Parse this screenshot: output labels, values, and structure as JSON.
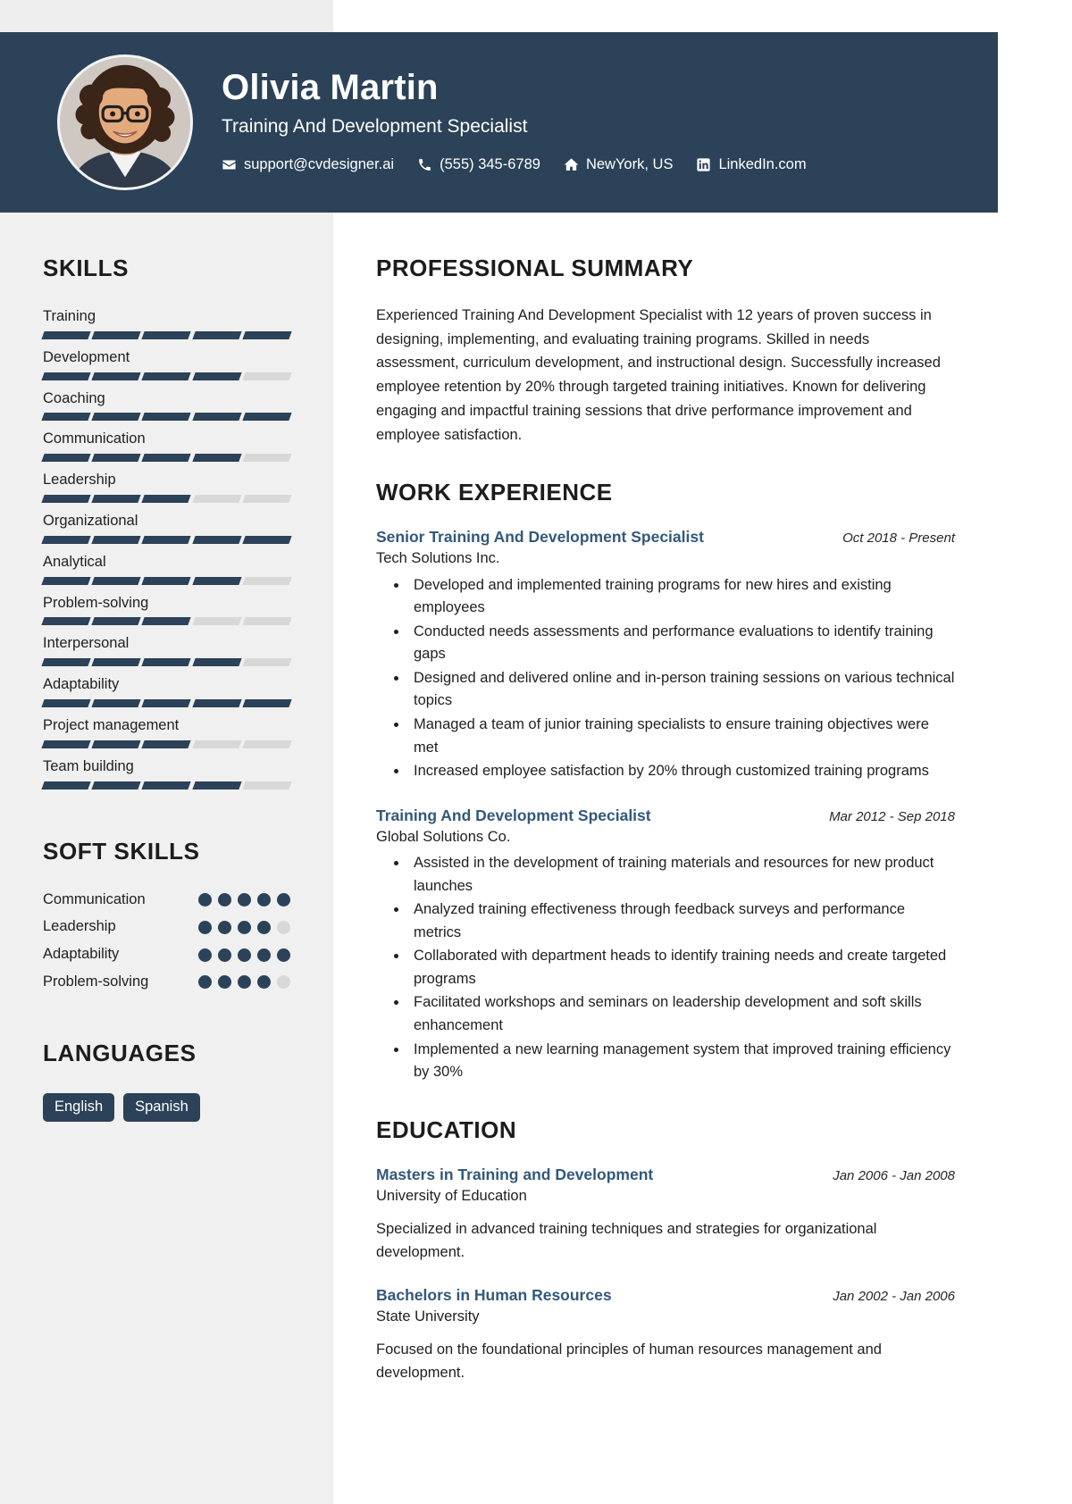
{
  "header": {
    "name": "Olivia Martin",
    "job_title": "Training And Development Specialist",
    "avatar_alt": "profile-photo",
    "contacts": [
      {
        "icon": "envelope-icon",
        "text": "support@cvdesigner.ai"
      },
      {
        "icon": "phone-icon",
        "text": "(555) 345-6789"
      },
      {
        "icon": "home-icon",
        "text": "NewYork, US"
      },
      {
        "icon": "linkedin-icon",
        "text": "LinkedIn.com"
      }
    ],
    "colors": {
      "banner": "#2b4258",
      "text": "#ffffff"
    }
  },
  "sidebar": {
    "skills_heading": "SKILLS",
    "skills_max": 5,
    "skills": [
      {
        "label": "Training",
        "level": 5
      },
      {
        "label": "Development",
        "level": 4
      },
      {
        "label": "Coaching",
        "level": 5
      },
      {
        "label": "Communication",
        "level": 4
      },
      {
        "label": "Leadership",
        "level": 3
      },
      {
        "label": "Organizational",
        "level": 5
      },
      {
        "label": "Analytical",
        "level": 4
      },
      {
        "label": "Problem-solving",
        "level": 3
      },
      {
        "label": "Interpersonal",
        "level": 4
      },
      {
        "label": "Adaptability",
        "level": 5
      },
      {
        "label": "Project management",
        "level": 3
      },
      {
        "label": "Team building",
        "level": 4
      }
    ],
    "soft_skills_heading": "SOFT SKILLS",
    "soft_skills_max": 5,
    "soft_skills": [
      {
        "label": "Communication",
        "level": 5
      },
      {
        "label": "Leadership",
        "level": 4
      },
      {
        "label": "Adaptability",
        "level": 5
      },
      {
        "label": "Problem-solving",
        "level": 4
      }
    ],
    "languages_heading": "LANGUAGES",
    "languages": [
      "English",
      "Spanish"
    ],
    "colors": {
      "background": "#f0f0f0",
      "filled": "#2b4258",
      "empty": "#d8d8d8"
    }
  },
  "main": {
    "summary_heading": "PROFESSIONAL SUMMARY",
    "summary_text": "Experienced Training And Development Specialist with 12 years of proven success in designing, implementing, and evaluating training programs. Skilled in needs assessment, curriculum development, and instructional design. Successfully increased employee retention by 20% through targeted training initiatives. Known for delivering engaging and impactful training sessions that drive performance improvement and employee satisfaction.",
    "experience_heading": "WORK EXPERIENCE",
    "experience": [
      {
        "title": "Senior Training And Development Specialist",
        "date": "Oct 2018 - Present",
        "company": "Tech Solutions Inc.",
        "bullets": [
          "Developed and implemented training programs for new hires and existing employees",
          "Conducted needs assessments and performance evaluations to identify training gaps",
          "Designed and delivered online and in-person training sessions on various technical topics",
          "Managed a team of junior training specialists to ensure training objectives were met",
          "Increased employee satisfaction by 20% through customized training programs"
        ]
      },
      {
        "title": "Training And Development Specialist",
        "date": "Mar 2012 - Sep 2018",
        "company": "Global Solutions Co.",
        "bullets": [
          "Assisted in the development of training materials and resources for new product launches",
          "Analyzed training effectiveness through feedback surveys and performance metrics",
          "Collaborated with department heads to identify training needs and create targeted programs",
          "Facilitated workshops and seminars on leadership development and soft skills enhancement",
          "Implemented a new learning management system that improved training efficiency by 30%"
        ]
      }
    ],
    "education_heading": "EDUCATION",
    "education": [
      {
        "degree": "Masters in Training and Development",
        "date": "Jan 2006 - Jan 2008",
        "school": "University of Education",
        "description": "Specialized in advanced training techniques and strategies for organizational development."
      },
      {
        "degree": "Bachelors in Human Resources",
        "date": "Jan 2002 - Jan 2006",
        "school": "State University",
        "description": "Focused on the foundational principles of human resources management and development."
      }
    ],
    "colors": {
      "entry_title": "#33587c",
      "heading": "#1c1c1c",
      "body": "#1f1f1f"
    }
  }
}
